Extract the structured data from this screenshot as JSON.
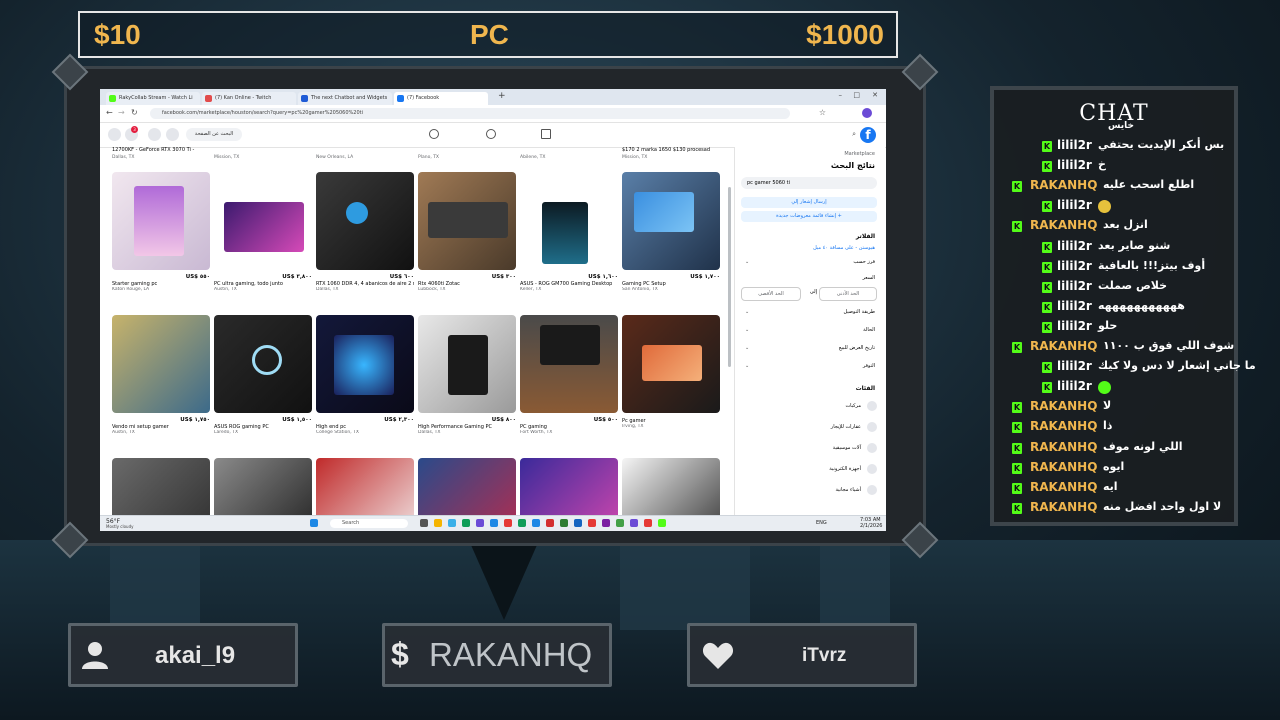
{
  "top_bar": {
    "left": "$10",
    "center": "PC",
    "right": "$1000"
  },
  "browser": {
    "tabs": [
      {
        "label": "RakyCollab Stream - Watch Li",
        "color": "#53fc18"
      },
      {
        "label": "(7) Kan Online - Twitch",
        "color": "#e14b4b"
      },
      {
        "label": "The next Chatbot and Widgets",
        "color": "#1f5bd6"
      },
      {
        "label": "(7) Facebook",
        "color": "#1877f2"
      }
    ],
    "url": "facebook.com/marketplace/houston/search?query=pc%20gamer%205060%20ti",
    "fb_search": "البحث عن الصفحة"
  },
  "marketplace": {
    "rows": [
      [
        {
          "price": "US$ ٥٥٠",
          "title": "Starter gaming pc",
          "loc": "Katon Rouge, LA"
        },
        {
          "price": "US$ ٣,٨٠٠",
          "title": "PC ultra gaming, todo junto",
          "loc": "Austin, TX"
        },
        {
          "price": "US$ ٦٠٠",
          "old": "US$ ٧٠٠",
          "title": "RTX 1060 DDR 4, 4 abanicos de aire 2 monitores uno de 60 gen y el",
          "loc": "Dallas, TX"
        },
        {
          "price": "US$ ٣٠٠",
          "title": "Rtx 4060ti Zotac",
          "loc": "Lubbock, TX"
        },
        {
          "price": "US$ ١,٦٠٠",
          "title": "ASUS - ROG GM700 Gaming Desktop",
          "loc": "Keller, TX"
        },
        {
          "price": "US$ ١,٧٠٠",
          "old": "US$ ٢,٣٠٠",
          "title": "Gaming PC Setup",
          "loc": "San Antonio, TX"
        }
      ],
      [
        {
          "price": "US$ ١,٧٥٠",
          "title": "Vendo mi setup gamer",
          "loc": "Austin, TX"
        },
        {
          "price": "US$ ١,٥٠٠",
          "old": "US$ ٢,٢٠٠",
          "title": "ASUS ROG gaming PC",
          "loc": "Laredo, TX"
        },
        {
          "price": "US$ ٢,٣٠٠",
          "title": "High end pc",
          "loc": "College Station, TX"
        },
        {
          "price": "US$ ٨٠٠",
          "title": "High Performance Gaming PC",
          "loc": "Dallas, TX"
        },
        {
          "price": "US$ ٥٠٠",
          "title": "PC gaming",
          "loc": "Fort Worth, TX"
        },
        {
          "price": "",
          "title": "Pc gamer",
          "loc": "Irving, TX"
        }
      ],
      [
        {
          "price": "",
          "title": "",
          "loc": ""
        },
        {
          "price": "",
          "title": "",
          "loc": ""
        },
        {
          "price": "",
          "title": "",
          "loc": ""
        },
        {
          "price": "",
          "title": "",
          "loc": ""
        },
        {
          "price": "",
          "title": "",
          "loc": ""
        },
        {
          "price": "",
          "title": "",
          "loc": ""
        }
      ]
    ],
    "top_partial": [
      {
        "title": "12700KF - GeForce RTX 3070 Ti -",
        "loc": "Dallas, TX"
      },
      {
        "title": "",
        "loc": "Mission, TX"
      },
      {
        "title": "",
        "loc": "New Orleans, LA"
      },
      {
        "title": "",
        "loc": "Plano, TX"
      },
      {
        "title": "",
        "loc": "Abilene, TX"
      },
      {
        "title": "$170 2 marka 1650 $130 procesad",
        "loc": "Mission, TX"
      }
    ]
  },
  "sidebar": {
    "breadcrumb": "Marketplace",
    "heading": "نتائج البحث",
    "search_value": "pc gamer 5060 ti",
    "alert_btn": "إرسال إشعار إلي",
    "create_btn": "+ إنشاء قائمة معروضات جديدة",
    "filters": "الفلاتر",
    "location": "هيوستن - على مسافة ٤٠ ميل",
    "sort": "فرز حسب",
    "price": "السعر",
    "min": "الحد الأدنى",
    "to": "إلى",
    "max": "الحد الأقصى",
    "delivery": "طريقة التوصيل",
    "condition": "الحالة",
    "date_listed": "تاريخ العرض للبيع",
    "availability": "التوفر",
    "categories": "الفئات",
    "cat_items": [
      "مركبات",
      "عقارات للإيجار",
      "آلات موسيقية",
      "أجهزة الكترونية",
      "أشياء مجانية"
    ]
  },
  "taskbar": {
    "weather_temp": "56°F",
    "weather_desc": "Mostly cloudy",
    "search": "Search",
    "lang": "ENG",
    "time": "7:03 AM",
    "date": "2/1/2026"
  },
  "chat": {
    "title": "CHAT",
    "partial_top": "خايس",
    "messages": [
      {
        "user": "lilil2r",
        "text": "بس أنكر الإيديت يحتفي",
        "user_color": "#ffffff",
        "indent": true
      },
      {
        "user": "lilil2r",
        "text": "خ",
        "user_color": "#ffffff",
        "indent": true
      },
      {
        "user": "RAKANHQ",
        "text": "اطلع اسحب عليه",
        "user_color": "#f0b64e",
        "indent": false
      },
      {
        "user": "lilil2r",
        "text": "",
        "emote": "#e6c13c",
        "user_color": "#ffffff",
        "indent": true
      },
      {
        "user": "RAKANHQ",
        "text": "انزل بعد",
        "user_color": "#f0b64e",
        "indent": false
      },
      {
        "user": "lilil2r",
        "text": "شنو صاير بعد",
        "user_color": "#ffffff",
        "indent": true
      },
      {
        "user": "lilil2r",
        "text": "أوف بيتز!!! بالعافية",
        "user_color": "#ffffff",
        "indent": true
      },
      {
        "user": "lilil2r",
        "text": "خلاص صملت",
        "user_color": "#ffffff",
        "indent": true
      },
      {
        "user": "lilil2r",
        "text": "هههههههههههه",
        "user_color": "#ffffff",
        "indent": true
      },
      {
        "user": "lilil2r",
        "text": "حلو",
        "user_color": "#ffffff",
        "indent": true
      },
      {
        "user": "RAKANHQ",
        "text": "شوف اللي فوق ب ١١٠٠",
        "user_color": "#f0b64e",
        "indent": false
      },
      {
        "user": "lilil2r",
        "text": "ما جاني إشعار لا دس ولا كيك",
        "user_color": "#ffffff",
        "indent": true
      },
      {
        "user": "lilil2r",
        "text": "",
        "emote": "#53fc18",
        "user_color": "#ffffff",
        "indent": true
      },
      {
        "user": "RAKANHQ",
        "text": "لا",
        "user_color": "#f0b64e",
        "indent": false
      },
      {
        "user": "RAKANHQ",
        "text": "ذا",
        "user_color": "#f0b64e",
        "indent": false
      },
      {
        "user": "RAKANHQ",
        "text": "اللي لونه موف",
        "user_color": "#f0b64e",
        "indent": false
      },
      {
        "user": "RAKANHQ",
        "text": "ايوه",
        "user_color": "#f0b64e",
        "indent": false
      },
      {
        "user": "RAKANHQ",
        "text": "ايه",
        "user_color": "#f0b64e",
        "indent": false
      },
      {
        "user": "RAKANHQ",
        "text": "لا اول واحد افضل منه",
        "user_color": "#f0b64e",
        "indent": false
      }
    ]
  },
  "bottom_panels": {
    "follower": "akai_l9",
    "donation": "RAKANHQ",
    "donation_symbol": "$",
    "subscriber": "iTvrz"
  },
  "colors": {
    "accent_orange": "#f0b64e",
    "kick_green": "#53fc18",
    "facebook_blue": "#1877f2"
  }
}
